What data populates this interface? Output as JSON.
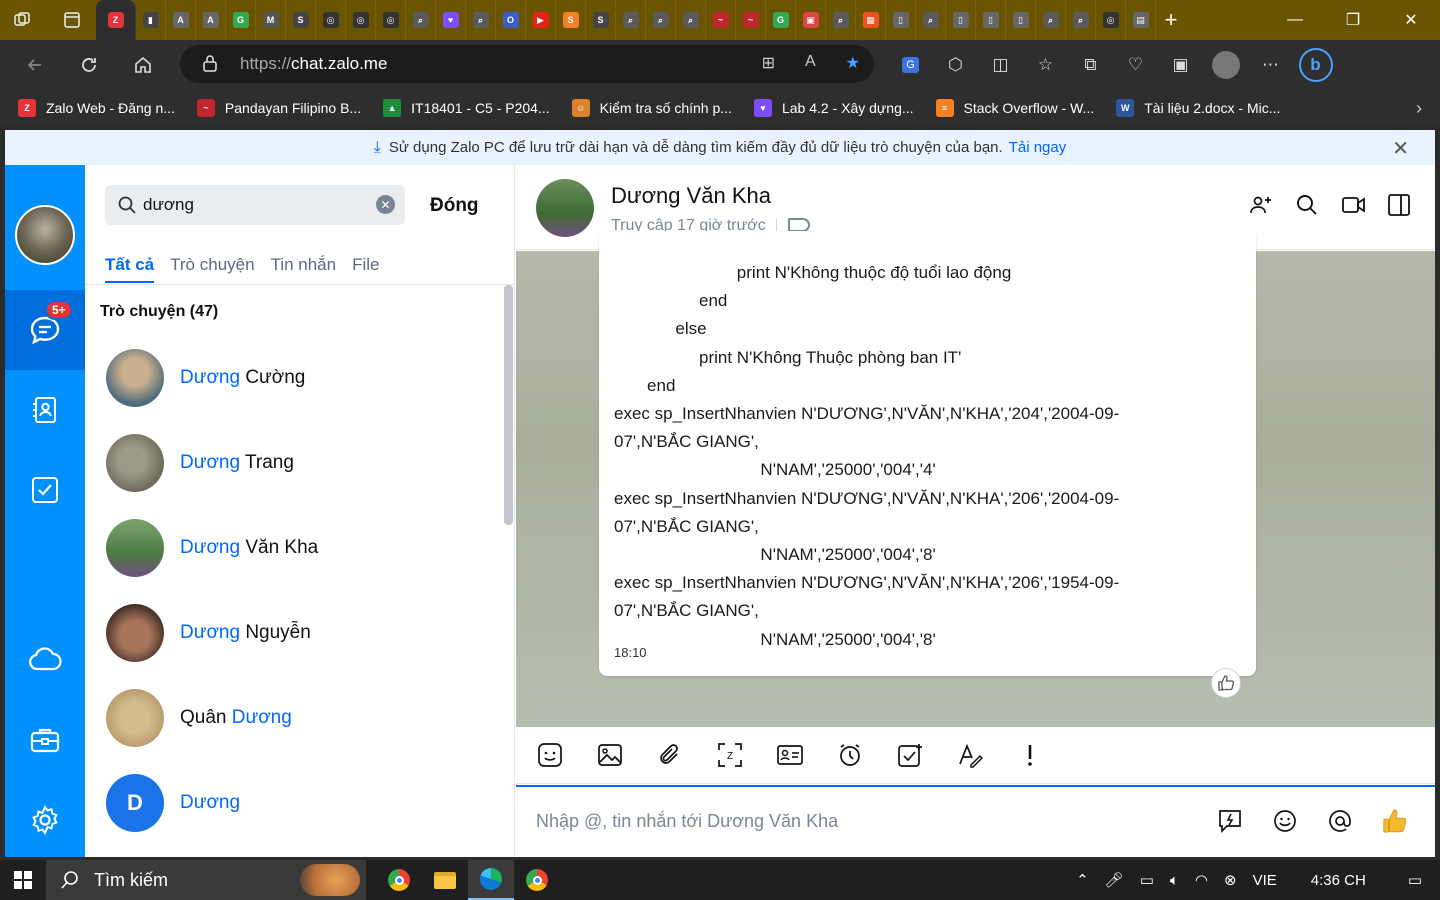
{
  "browser": {
    "url_protocol": "https://",
    "url_host": "chat.zalo.me",
    "window_controls": [
      "—",
      "❐",
      "✕"
    ],
    "new_tab": "+"
  },
  "favorites": [
    {
      "label": "Zalo Web - Đăng n...",
      "color": "#e5333b",
      "icon": "zalo-icon"
    },
    {
      "label": "Pandayan Filipino B...",
      "color": "#c0262d",
      "icon": "pandayan-icon"
    },
    {
      "label": "IT18401 - C5 - P204...",
      "color": "#1e8e3e",
      "icon": "drive-icon"
    },
    {
      "label": "Kiểm tra số chính p...",
      "color": "#d9822b",
      "icon": "person-icon"
    },
    {
      "label": "Lab 4.2 - Xây dựng...",
      "color": "#7b4dff",
      "icon": "heart-icon"
    },
    {
      "label": "Stack Overflow - W...",
      "color": "#f48024",
      "icon": "stackoverflow-icon"
    },
    {
      "label": "Tài liệu 2.docx - Mic...",
      "color": "#2b579a",
      "icon": "word-icon"
    }
  ],
  "banner": {
    "text": "Sử dụng Zalo PC để lưu trữ dài hạn và dễ dàng tìm kiếm đầy đủ dữ liệu trò chuyện của bạn.",
    "link": "Tải ngay"
  },
  "nav": {
    "badge": "5+"
  },
  "search": {
    "query": "dương",
    "close_label": "Đóng",
    "tabs": [
      "Tất cả",
      "Trò chuyện",
      "Tin nhắn",
      "File"
    ],
    "section_title": "Trò chuyện (47)",
    "results": [
      {
        "highlight": "Dương",
        "rest": " Cường",
        "order": "hl-first",
        "avatar": "#4f6b7a"
      },
      {
        "highlight": "Dương",
        "rest": " Trang",
        "order": "hl-first",
        "avatar": "#6e6a5c"
      },
      {
        "highlight": "Dương",
        "rest": " Văn Kha",
        "order": "hl-first",
        "avatar": "#4d7a45"
      },
      {
        "highlight": "Dương",
        "rest": " Nguyễn",
        "order": "hl-first",
        "avatar": "#3a2a22"
      },
      {
        "prefix": "Quân ",
        "highlight": "Dương",
        "order": "hl-last",
        "avatar": "#b89a6a"
      },
      {
        "highlight": "Dương",
        "letter": "D",
        "order": "hl-first",
        "avatar": "#1a73e8"
      }
    ]
  },
  "chat": {
    "name": "Dương Văn Kha",
    "status": "Truy cập 17 giờ trước",
    "message_lines": [
      "                          print N'Không thuộc độ tuổi lao động",
      "                  end",
      "             else",
      "                  print N'Không Thuộc phòng ban IT'",
      "       end",
      "exec sp_InsertNhanvien N'DƯƠNG',N'VĂN',N'KHA','204','2004-09-",
      "07',N'BẮC GIANG',",
      "                               N'NAM','25000','004','4'",
      "exec sp_InsertNhanvien N'DƯƠNG',N'VĂN',N'KHA','206','2004-09-",
      "07',N'BẮC GIANG',",
      "                               N'NAM','25000','004','8'",
      "exec sp_InsertNhanvien N'DƯƠNG',N'VĂN',N'KHA','206','1954-09-",
      "07',N'BẮC GIANG',",
      "                               N'NAM','25000','004','8'"
    ],
    "time": "18:10",
    "input_placeholder": "Nhập @, tin nhắn tới Dương Văn Kha"
  },
  "taskbar": {
    "search_placeholder": "Tìm kiếm",
    "lang": "VIE",
    "time": "4:36 CH"
  }
}
